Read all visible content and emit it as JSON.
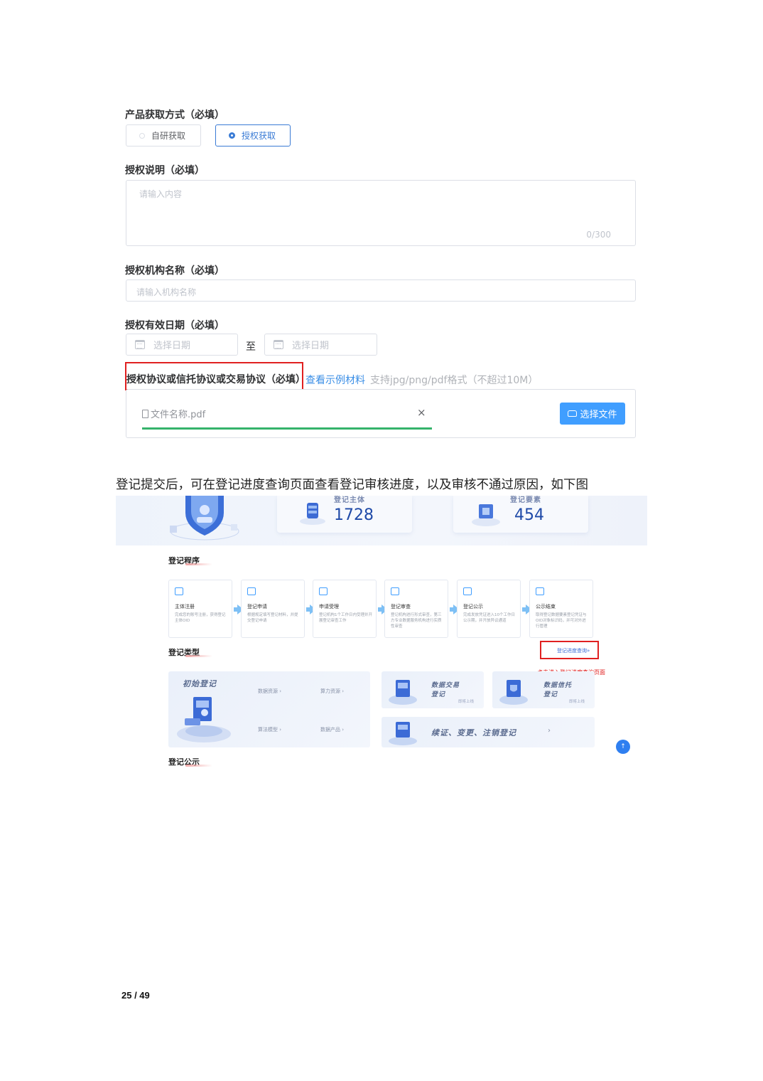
{
  "form": {
    "acquisition_label": "产品获取方式（必填）",
    "acquisition_options": [
      "自研获取",
      "授权获取"
    ],
    "auth_desc_label": "授权说明（必填）",
    "auth_desc_placeholder": "请输入内容",
    "auth_desc_counter": "0/300",
    "auth_org_label": "授权机构名称（必填）",
    "auth_org_placeholder": "请输入机构名称",
    "auth_date_label": "授权有效日期（必填）",
    "date_start_placeholder": "选择日期",
    "date_separator": "至",
    "date_end_placeholder": "选择日期",
    "agreement_label": "授权协议或信托协议或交易协议（必填）",
    "sample_link": "查看示例材料",
    "format_hint": "支持jpg/png/pdf格式（不超过10M）",
    "file_name": "文件名称.pdf",
    "remove_symbol": "×",
    "upload_button": "选择文件",
    "upload_progress": 1.0
  },
  "caption": "登记提交后，可在登记进度查询页面查看登记审核进度，以及审核不通过原因，如下图",
  "screenshot": {
    "stat_subject_title": "登记主体",
    "stat_subject_value": "1728",
    "stat_element_title": "登记要素",
    "stat_element_value": "454",
    "procedure_title": "登记程序",
    "steps": [
      {
        "title": "主体注册",
        "desc": "完成您的账号注册，获得登记主体OID"
      },
      {
        "title": "登记申请",
        "desc": "根据规定填写登记材料，并提交登记申请"
      },
      {
        "title": "申请受理",
        "desc": "登记机构1个工作日内受理并开展登记审查工作"
      },
      {
        "title": "登记审查",
        "desc": "登记机构进行形式审查，第三方专业数据服务机构进行实质性审查"
      },
      {
        "title": "登记公示",
        "desc": "完成发放凭证进入10个工作日公示期，并开放异议通道"
      },
      {
        "title": "公示结束",
        "desc": "取得登记数据要素登记凭证与OID对象标识码，并可对外进行管理"
      }
    ],
    "type_title": "登记类型",
    "progress_link": "登记进度查询»",
    "red_note": "点击进入登记进度查询页面",
    "initial_title": "初始登记",
    "initial_links": [
      "数据资源",
      "算力资源",
      "算法模型",
      "数据产品"
    ],
    "trade_title_1": "数据交易",
    "trade_title_2": "登记",
    "trade_sub": "即将上线",
    "trust_title_1": "数据信托",
    "trust_title_2": "登记",
    "trust_sub": "即将上线",
    "renew_title": "续证、变更、注销登记",
    "chevron": "›",
    "publicity_title": "登记公示",
    "up_arrow": "↑"
  },
  "page_number": "25 / 49"
}
